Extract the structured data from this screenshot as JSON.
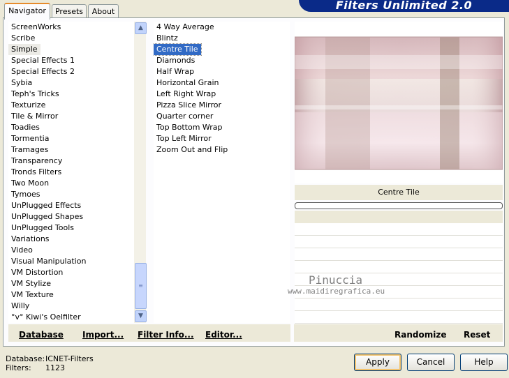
{
  "tabs": [
    {
      "label": "Navigator"
    },
    {
      "label": "Presets"
    },
    {
      "label": "About"
    }
  ],
  "banner_title": "Filters Unlimited 2.0",
  "categories": [
    "ScreenWorks",
    "Scribe",
    "Simple",
    "Special Effects 1",
    "Special Effects 2",
    "Sybia",
    "Teph's Tricks",
    "Texturize",
    "Tile & Mirror",
    "Toadies",
    "Tormentia",
    "Tramages",
    "Transparency",
    "Tronds Filters",
    "Two Moon",
    "Tymoes",
    "UnPlugged Effects",
    "UnPlugged Shapes",
    "UnPlugged Tools",
    "Variations",
    "Video",
    "Visual Manipulation",
    "VM Distortion",
    "VM Stylize",
    "VM Texture",
    "Willy",
    "°v° Kiwi's Oelfilter"
  ],
  "selected_category": "Simple",
  "filters": [
    "4 Way Average",
    "Blintz",
    "Centre Tile",
    "Diamonds",
    "Half Wrap",
    "Horizontal Grain",
    "Left Right Wrap",
    "Pizza Slice Mirror",
    "Quarter corner",
    "Top Bottom Wrap",
    "Top Left Mirror",
    "Zoom Out and Flip"
  ],
  "selected_filter": "Centre Tile",
  "params": {
    "label": "Centre Tile"
  },
  "actions": {
    "database": "Database",
    "import": "Import...",
    "filter_info": "Filter Info...",
    "editor": "Editor...",
    "randomize": "Randomize",
    "reset": "Reset"
  },
  "status": {
    "database_label": "Database:",
    "database_value": "ICNET-Filters",
    "filters_label": "Filters:",
    "filters_value": "1123"
  },
  "buttons": {
    "apply": "Apply",
    "cancel": "Cancel",
    "help": "Help"
  },
  "watermark": {
    "name": "Pinuccia",
    "url": "www.maidiregrafica.eu"
  }
}
